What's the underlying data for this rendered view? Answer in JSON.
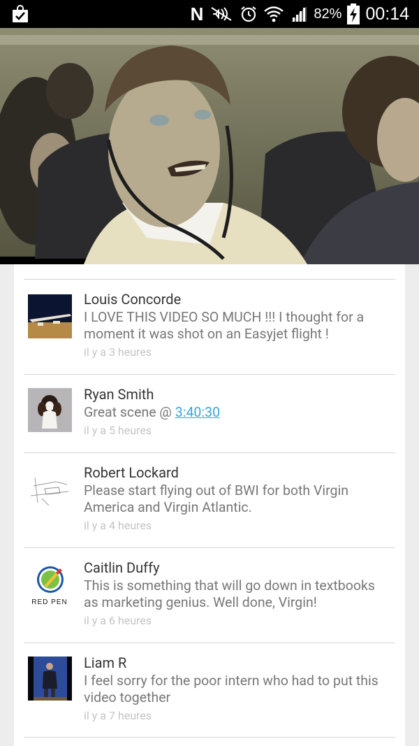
{
  "status_bar": {
    "left_icon": "bag-check-icon",
    "nfc_label": "N",
    "battery_percent": "82%",
    "time": "00:14"
  },
  "video": {
    "content": "video-player"
  },
  "comments": [
    {
      "author": "Louis Concorde",
      "text": "I LOVE THIS VIDEO SO MUCH !!!  I thought for a moment it was shot on an Easyjet flight !",
      "time": "il y a 3 heures",
      "avatar": "concorde-photo"
    },
    {
      "author": "Ryan Smith",
      "text_prefix": "Great scene @ ",
      "link": "3:40:30",
      "time": "il y a 5 heures",
      "avatar": "dog-photo"
    },
    {
      "author": "Robert Lockard",
      "text": "Please start flying out of BWI for both Virgin America and Virgin Atlantic.",
      "time": "il y a 4 heures",
      "avatar": "aircraft-sketch"
    },
    {
      "author": "Caitlin Duffy",
      "text": "This is something that will go down in textbooks as marketing genius. Well done, Virgin!",
      "time": "il y a 6 heures",
      "avatar": "red-pen-logo",
      "avatar_text": "RED PEN"
    },
    {
      "author": "Liam R",
      "text": "I feel sorry for the poor intern who had to put this video together",
      "time": "il y a 7 heures",
      "avatar": "person-photo"
    }
  ]
}
